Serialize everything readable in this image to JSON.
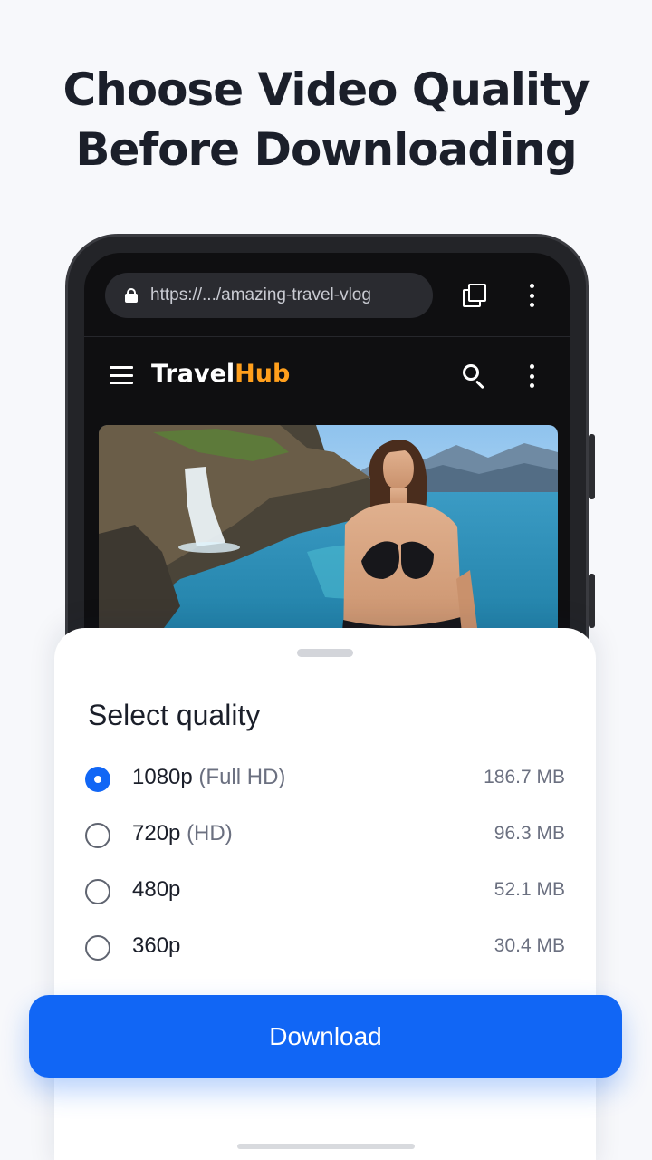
{
  "headline": {
    "line1": "Choose Video Quality",
    "line2": "Before Downloading"
  },
  "browser": {
    "url": "https://.../amazing-travel-vlog",
    "icons": [
      "lock-icon",
      "tabs-icon",
      "more-vert-icon"
    ]
  },
  "site": {
    "brand_part1": "Travel",
    "brand_part2": "Hub",
    "icons": [
      "menu-icon",
      "search-icon",
      "more-vert-icon"
    ]
  },
  "thumbnail": {
    "scene": "woman in black bikini beside turquoise lagoon with waterfall and mountains"
  },
  "sheet": {
    "title": "Select quality",
    "options": [
      {
        "res": "1080p",
        "tag": "(Full HD)",
        "size": "186.7 MB",
        "selected": true
      },
      {
        "res": "720p",
        "tag": "(HD)",
        "size": "96.3 MB",
        "selected": false
      },
      {
        "res": "480p",
        "tag": "",
        "size": "52.1 MB",
        "selected": false
      },
      {
        "res": "360p",
        "tag": "",
        "size": "30.4 MB",
        "selected": false
      }
    ],
    "download_label": "Download"
  },
  "colors": {
    "accent": "#1166f5",
    "brand_orange": "#ff9f1c",
    "phone_bg": "#0f0f11"
  }
}
